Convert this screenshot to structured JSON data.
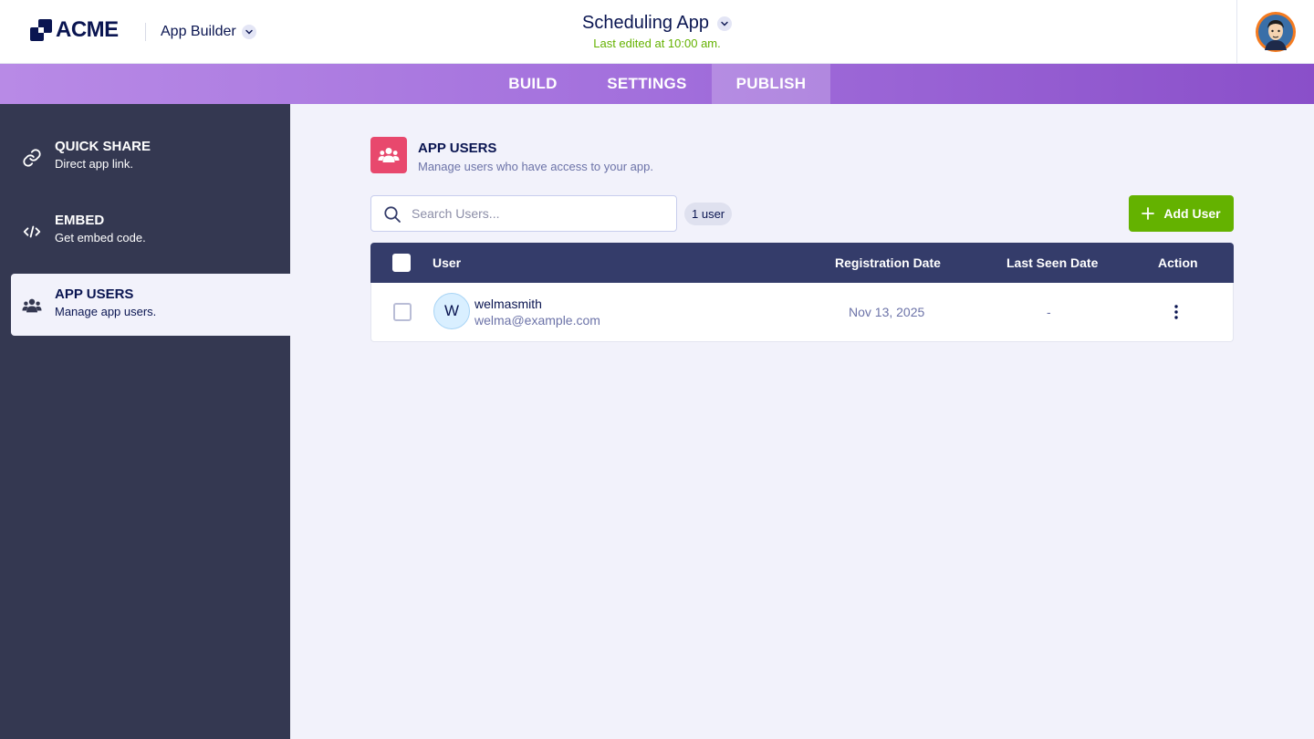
{
  "header": {
    "logo_text": "ACME",
    "product_name": "App Builder",
    "app_title": "Scheduling App",
    "last_edited": "Last edited at 10:00 am."
  },
  "nav": {
    "tabs": [
      {
        "label": "BUILD",
        "active": false
      },
      {
        "label": "SETTINGS",
        "active": false
      },
      {
        "label": "PUBLISH",
        "active": true
      }
    ]
  },
  "sidebar": {
    "items": [
      {
        "title": "QUICK SHARE",
        "subtitle": "Direct app link.",
        "icon": "link-icon",
        "active": false
      },
      {
        "title": "EMBED",
        "subtitle": "Get embed code.",
        "icon": "code-icon",
        "active": false
      },
      {
        "title": "APP USERS",
        "subtitle": "Manage app users.",
        "icon": "users-icon",
        "active": true
      }
    ]
  },
  "main": {
    "section_title": "APP USERS",
    "section_subtitle": "Manage users who have access to your app.",
    "search": {
      "placeholder": "Search Users...",
      "value": ""
    },
    "user_count": "1 user",
    "add_button_label": "Add User",
    "table": {
      "columns": [
        "User",
        "Registration Date",
        "Last Seen Date",
        "Action"
      ],
      "rows": [
        {
          "initial": "W",
          "username": "welmasmith",
          "email": "welma@example.com",
          "registration_date": "Nov 13, 2025",
          "last_seen": "-"
        }
      ]
    }
  },
  "colors": {
    "accent_green": "#64b200",
    "nav_purple": "#a26fdc",
    "sidebar_bg": "#343851",
    "table_header": "#343c6a",
    "section_icon_bg": "#e8486d"
  }
}
